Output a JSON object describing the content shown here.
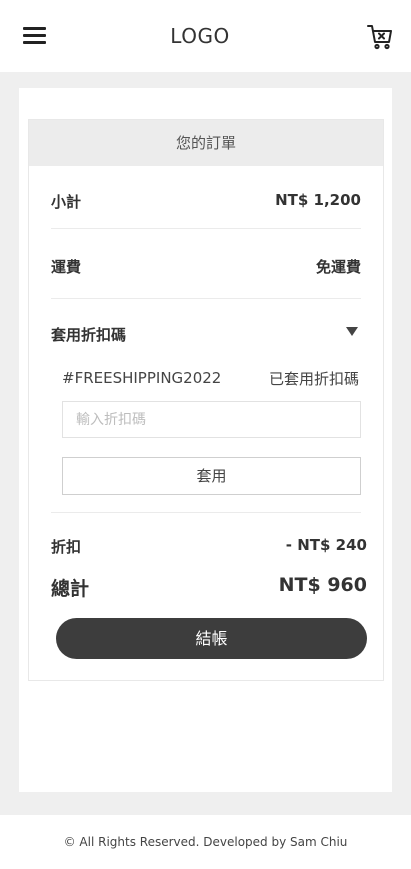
{
  "header": {
    "logo": "LOGO",
    "menu_icon": "hamburger-menu-icon",
    "cart_icon": "shopping-cart-icon"
  },
  "order": {
    "title": "您的訂單",
    "subtotal_label": "小計",
    "subtotal_value": "NT$ 1,200",
    "shipping_label": "運費",
    "shipping_value": "免運費",
    "coupon_label": "套用折扣碼",
    "applied_code": "#FREESHIPPING2022",
    "applied_status": "已套用折扣碼",
    "coupon_placeholder": "輸入折扣碼",
    "apply_button": "套用",
    "discount_label": "折扣",
    "discount_value": "- NT$ 240",
    "total_label": "總計",
    "total_value": "NT$ 960",
    "checkout_button": "結帳"
  },
  "footer": {
    "copyright": "© All Rights Reserved. Developed by Sam Chiu"
  },
  "colors": {
    "page_bg": "#efefef",
    "header_bg": "#ececec",
    "checkout_bg": "#3d3d3d"
  }
}
